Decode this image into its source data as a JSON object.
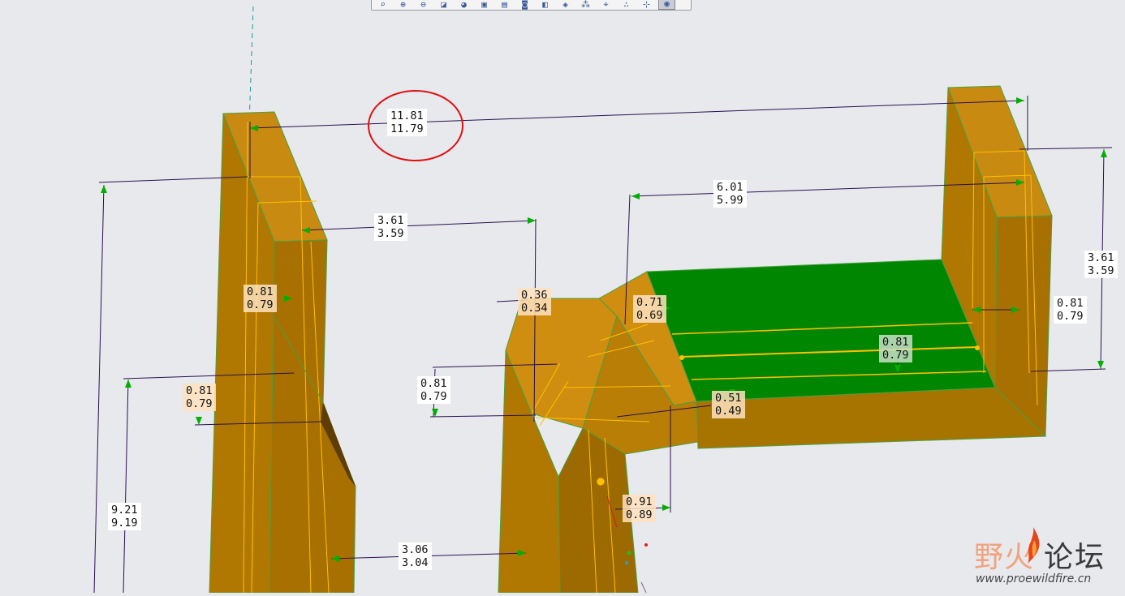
{
  "toolbar": {
    "buttons": [
      {
        "icon": "zoom-box-icon",
        "glyph": "⌕"
      },
      {
        "icon": "zoom-in-icon",
        "glyph": "⊕"
      },
      {
        "icon": "zoom-out-icon",
        "glyph": "⊖"
      },
      {
        "icon": "refit-icon",
        "glyph": "◪"
      },
      {
        "icon": "shading-icon",
        "glyph": "◕"
      },
      {
        "icon": "saved-views-icon",
        "glyph": "▣"
      },
      {
        "icon": "layers-icon",
        "glyph": "▤"
      },
      {
        "icon": "camera-icon",
        "glyph": "◙"
      },
      {
        "icon": "orient-icon",
        "glyph": "◧"
      },
      {
        "icon": "display-style-icon",
        "glyph": "◈"
      },
      {
        "icon": "datum-planes-icon",
        "glyph": "⁂"
      },
      {
        "icon": "datum-axes-icon",
        "glyph": "⌖"
      },
      {
        "icon": "datum-points-icon",
        "glyph": "∴"
      },
      {
        "icon": "csys-icon",
        "glyph": "⊹"
      },
      {
        "icon": "annotation-display-icon",
        "glyph": "◉",
        "active": true
      }
    ]
  },
  "dimensions": {
    "top_span": {
      "upper": "11.81",
      "lower": "11.79"
    },
    "inner_span": {
      "upper": "6.01",
      "lower": "5.99"
    },
    "left_gap": {
      "upper": "3.61",
      "lower": "3.59"
    },
    "right_height": {
      "upper": "3.61",
      "lower": "3.59"
    },
    "left_wall": {
      "upper": "0.81",
      "lower": "0.79"
    },
    "small_gap": {
      "upper": "0.36",
      "lower": "0.34"
    },
    "chamfer": {
      "upper": "0.71",
      "lower": "0.69"
    },
    "right_wall": {
      "upper": "0.81",
      "lower": "0.79"
    },
    "green_face": {
      "upper": "0.81",
      "lower": "0.79"
    },
    "left_mid": {
      "upper": "0.81",
      "lower": "0.79"
    },
    "step_left": {
      "upper": "0.81",
      "lower": "0.79"
    },
    "step_center": {
      "upper": "0.51",
      "lower": "0.49"
    },
    "post_width": {
      "upper": "0.91",
      "lower": "0.89"
    },
    "tall_left": {
      "upper": "9.21",
      "lower": "9.19"
    },
    "bottom_gap": {
      "upper": "3.06",
      "lower": "3.04"
    }
  },
  "colors": {
    "body": "#b07800",
    "body_light": "#c88a10",
    "body_dark": "#8a5c00",
    "selected_face": "#008600",
    "dimension_line": "#2a1050",
    "arrow": "#00b000",
    "highlight_circle": "#e01010",
    "edge": "#48a040",
    "edge_yellow": "#ffc000"
  },
  "watermark": {
    "cn_part1": "野火",
    "cn_part2": "论坛",
    "url": "www.proewildfire.cn"
  }
}
